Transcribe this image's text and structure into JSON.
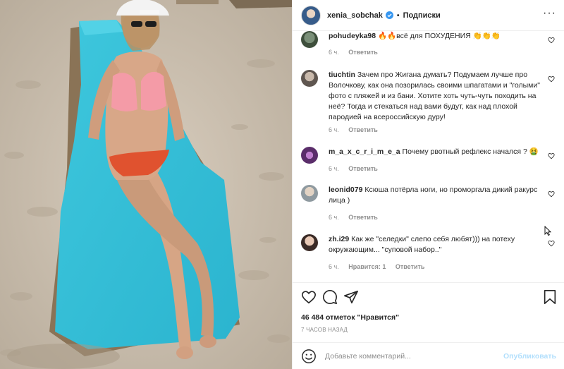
{
  "header": {
    "username": "xenia_sobchak",
    "separator": "•",
    "follow_label": "Подписки",
    "more_label": "···"
  },
  "comments": [
    {
      "username": "pohudeyka98",
      "text": "🔥🔥всё для ПОХУДЕНИЯ 👏👏👏",
      "time": "6 ч.",
      "reply": "Ответить",
      "likes": ""
    },
    {
      "username": "tiuchtin",
      "text": "Зачем про Жигана думать? Подумаем лучше про Волочкову, как она позорилась своими шпагатами и \"голыми\" фото с пляжей и из бани. Хотите хоть чуть-чуть походить на неё? Тогда и стекаться над вами будут, как над плохой пародией на всероссийскую дуру!",
      "time": "6 ч.",
      "reply": "Ответить",
      "likes": ""
    },
    {
      "username": "m_a_x_c_r_i_m_e_a",
      "text": "Почему рвотный рефлекс начался ? 🤮",
      "time": "6 ч.",
      "reply": "Ответить",
      "likes": ""
    },
    {
      "username": "leonid079",
      "text": "Ксюша потёрла ноги, но проморгала дикий ракурс лица )",
      "time": "6 ч.",
      "reply": "Ответить",
      "likes": ""
    },
    {
      "username": "zh.i29",
      "text": "Как же \"селедки\" слепо себя любят))) на потеху окружающим... \"суповой набор..\"",
      "time": "6 ч.",
      "reply": "Ответить",
      "likes": "Нравится: 1"
    }
  ],
  "actions": {
    "likes_text": "46 484 отметок \"Нравится\"",
    "time_ago": "7 ЧАСОВ НАЗАД"
  },
  "add_comment": {
    "placeholder": "Добавьте комментарий...",
    "publish_label": "Опубликовать"
  },
  "icons": {
    "like": "heart-icon",
    "comment": "comment-icon",
    "share": "share-icon",
    "save": "bookmark-icon",
    "emoji": "emoji-icon",
    "verified": "verified-badge-icon"
  },
  "colors": {
    "text": "#262626",
    "muted": "#8e8e8e",
    "verified": "#3897f0",
    "publish_disabled": "#b2dffc",
    "divider": "#efefef"
  }
}
